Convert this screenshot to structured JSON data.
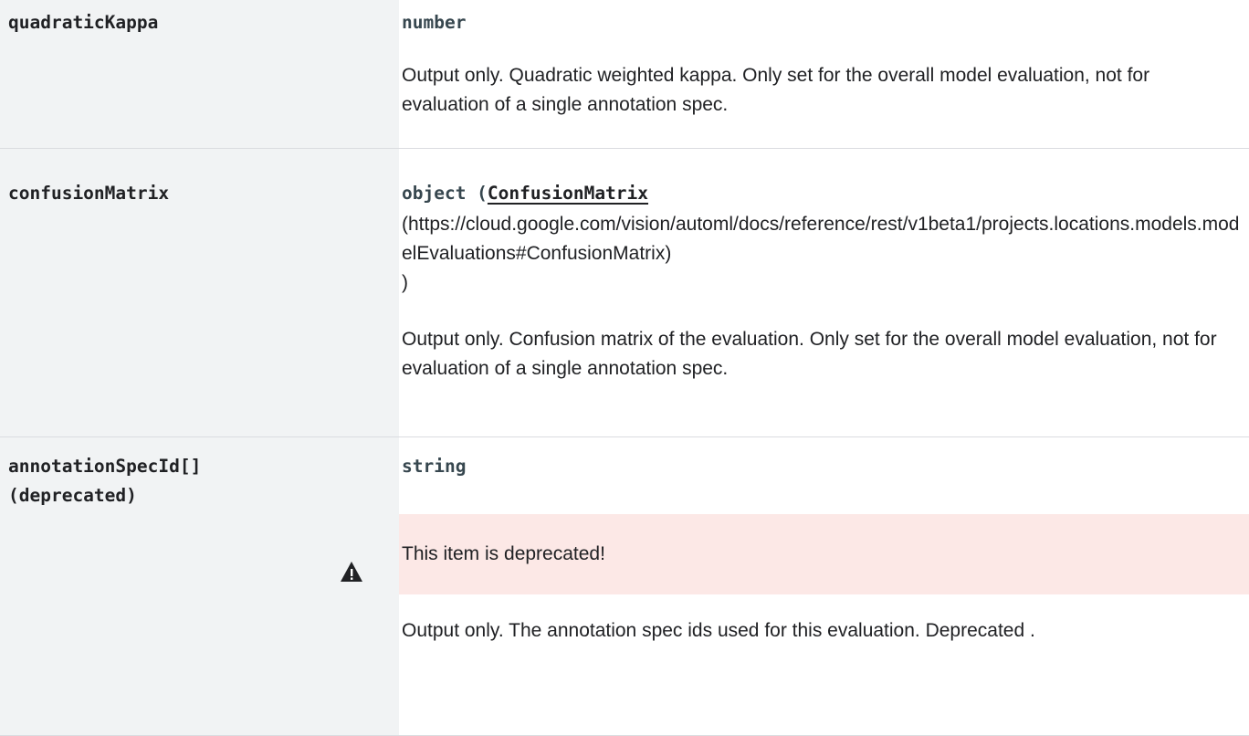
{
  "fields": [
    {
      "name": "quadraticKappa",
      "type": "number",
      "description": "Output only. Quadratic weighted kappa. Only set for the overall model evaluation, not for evaluation of a single annotation spec."
    },
    {
      "name": "confusionMatrix",
      "type_prefix": "object (",
      "type_link": "ConfusionMatrix",
      "type_url": "(https://cloud.google.com/vision/automl/docs/reference/rest/v1beta1/projects.locations.models.modelEvaluations#ConfusionMatrix)",
      "type_suffix": ")",
      "description": "Output only. Confusion matrix of the evaluation. Only set for the overall model evaluation, not for evaluation of a single annotation spec."
    },
    {
      "name": "annotationSpecId[]",
      "name_note": "(deprecated)",
      "type": "string",
      "deprecated_notice": "This item is deprecated!",
      "description": "Output only. The annotation spec ids used for this evaluation. Deprecated ."
    }
  ],
  "icons": {
    "warning": "warning-icon"
  },
  "colors": {
    "name_column_bg": "#f1f3f4",
    "deprecated_bg": "#fce8e6",
    "divider": "#dadce0"
  }
}
